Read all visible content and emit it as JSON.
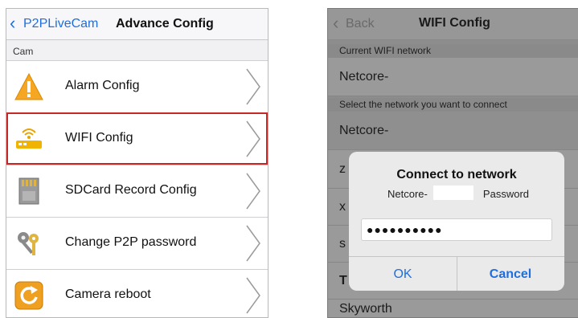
{
  "left": {
    "nav": {
      "back_chevron": "‹",
      "back_label": "P2PLiveCam",
      "title": "Advance Config"
    },
    "section_label": "Cam",
    "items": [
      {
        "label": "Alarm Config",
        "icon": "warning-icon"
      },
      {
        "label": "WIFI Config",
        "icon": "wifi-router-icon",
        "selected": true
      },
      {
        "label": "SDCard Record Config",
        "icon": "sd-card-icon"
      },
      {
        "label": "Change P2P password",
        "icon": "keys-icon"
      },
      {
        "label": "Camera reboot",
        "icon": "reboot-icon"
      }
    ],
    "colors": {
      "accent": "#1d6fe0",
      "selection": "#c62828"
    }
  },
  "right": {
    "nav": {
      "back_chevron": "‹",
      "back_label": "Back",
      "title": "WIFI Config"
    },
    "current_section": "Current WIFI network",
    "current_network": "Netcore-",
    "select_section": "Select the network you want to connect",
    "networks": [
      "Netcore-",
      "z",
      "x",
      "s",
      "T",
      "Skyworth"
    ],
    "dialog": {
      "title": "Connect to network",
      "ssid": "Netcore-",
      "password_label": "Password",
      "password_value": "●●●●●●●●●●",
      "ok_label": "OK",
      "cancel_label": "Cancel"
    }
  }
}
